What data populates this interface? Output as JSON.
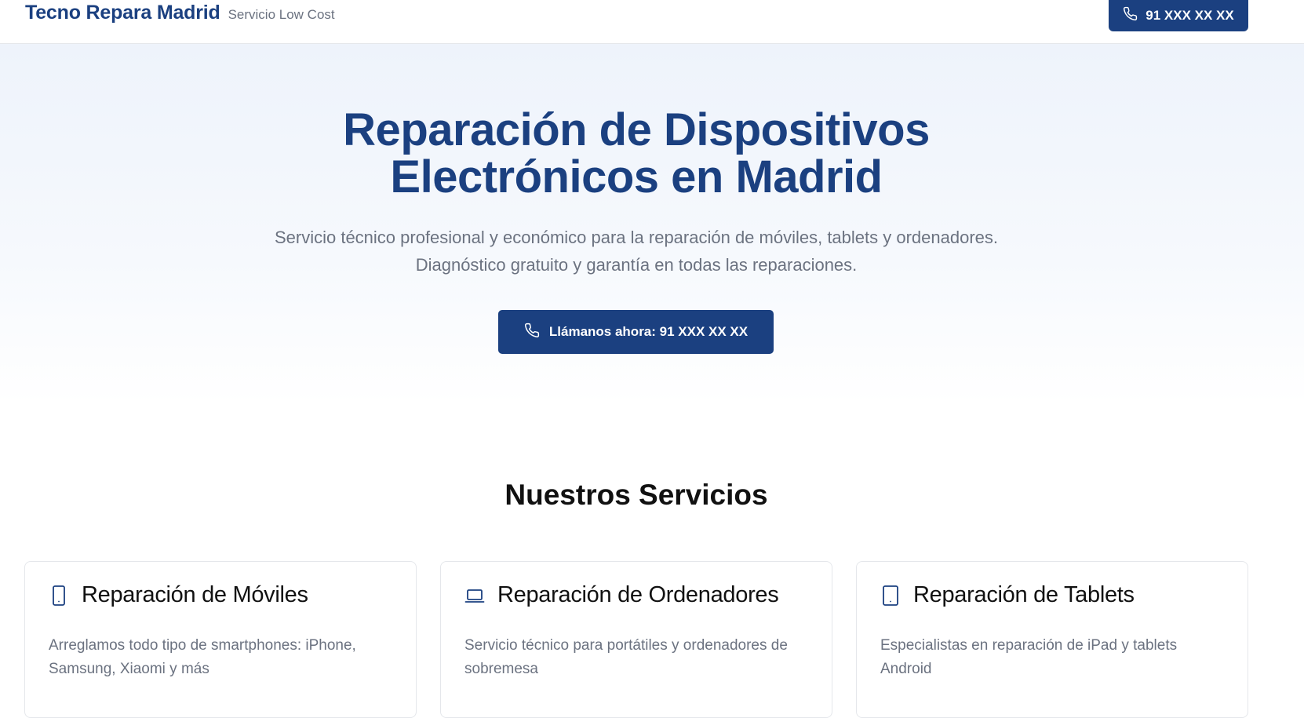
{
  "header": {
    "brand_name": "Tecno Repara Madrid",
    "brand_tagline": "Servicio Low Cost",
    "phone_label": "91 XXX XX XX",
    "phone_icon": "phone-icon"
  },
  "hero": {
    "title_line1": "Reparación de Dispositivos",
    "title_line2": "Electrónicos en Madrid",
    "subtitle_line1": "Servicio técnico profesional y económico para la reparación de móviles, tablets y ordenadores.",
    "subtitle_line2": "Diagnóstico gratuito y garantía en todas las reparaciones.",
    "cta_label": "Llámanos ahora: 91 XXX XX XX",
    "cta_icon": "phone-icon"
  },
  "services": {
    "title": "Nuestros Servicios",
    "items": [
      {
        "icon": "smartphone-icon",
        "title": "Reparación de Móviles",
        "description": "Arreglamos todo tipo de smartphones: iPhone, Samsung, Xiaomi y más"
      },
      {
        "icon": "laptop-icon",
        "title": "Reparación de Ordenadores",
        "description": "Servicio técnico para portátiles y ordenadores de sobremesa"
      },
      {
        "icon": "tablet-icon",
        "title": "Reparación de Tablets",
        "description": "Especialistas en reparación de iPad y tablets Android"
      }
    ]
  },
  "colors": {
    "brand": "#1b4080",
    "muted_text": "#6b7280",
    "border": "#e5e7eb"
  }
}
